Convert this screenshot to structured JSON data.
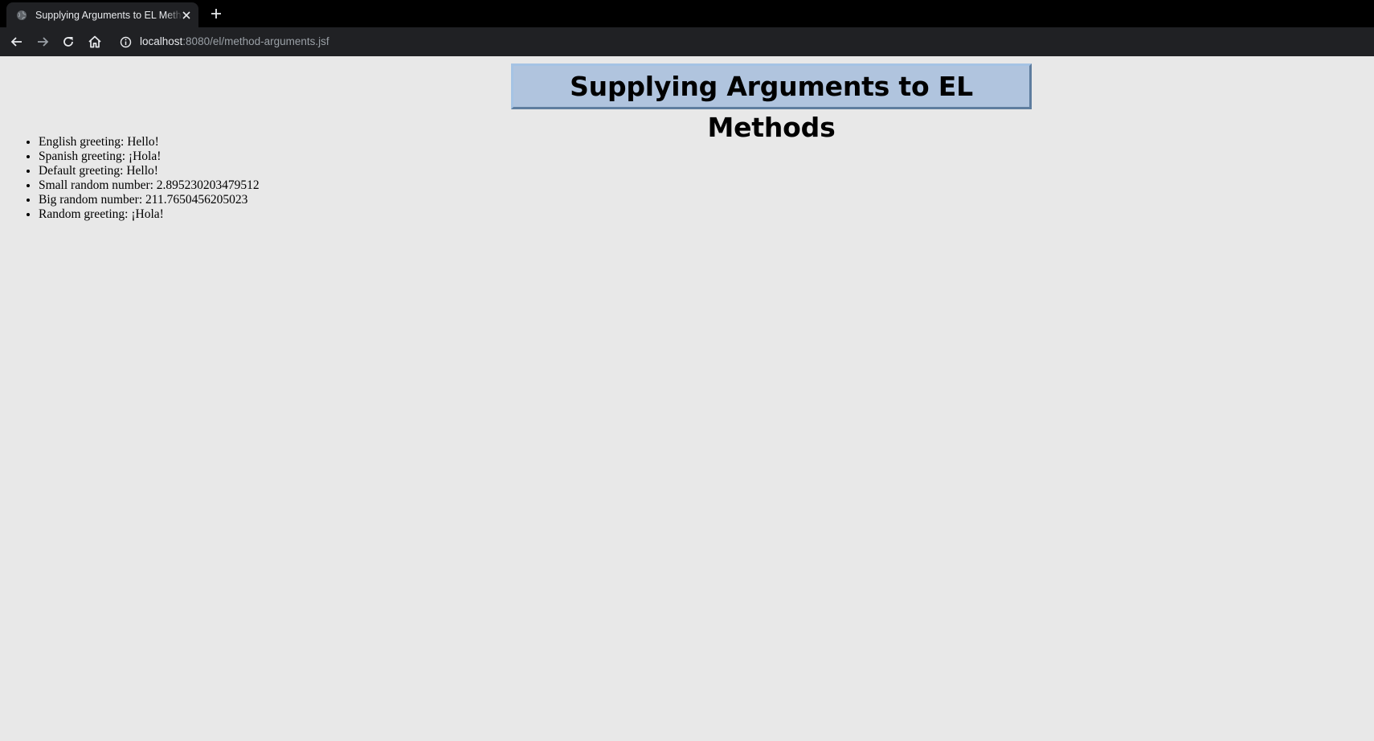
{
  "browser": {
    "tab": {
      "title": "Supplying Arguments to EL Methods",
      "favicon": "globe-icon"
    },
    "url": {
      "host": "localhost",
      "rest": ":8080/el/method-arguments.jsf"
    },
    "icons": {
      "back": "back-arrow-icon",
      "forward": "forward-arrow-icon",
      "reload": "reload-icon",
      "home": "home-icon",
      "info": "info-icon",
      "close": "close-icon",
      "new_tab": "plus-icon"
    },
    "colors": {
      "tabstrip": "#000000",
      "toolbar": "#202124",
      "text": "#e8eaed",
      "muted": "#9aa0a6"
    }
  },
  "page": {
    "title": "Supplying Arguments to EL Methods",
    "title_background": "#b0c4de",
    "background": "#e8e8e8",
    "items": [
      "English greeting: Hello!",
      "Spanish greeting: ¡Hola!",
      "Default greeting: Hello!",
      "Small random number: 2.895230203479512",
      "Big random number: 211.7650456205023",
      "Random greeting: ¡Hola!"
    ]
  }
}
